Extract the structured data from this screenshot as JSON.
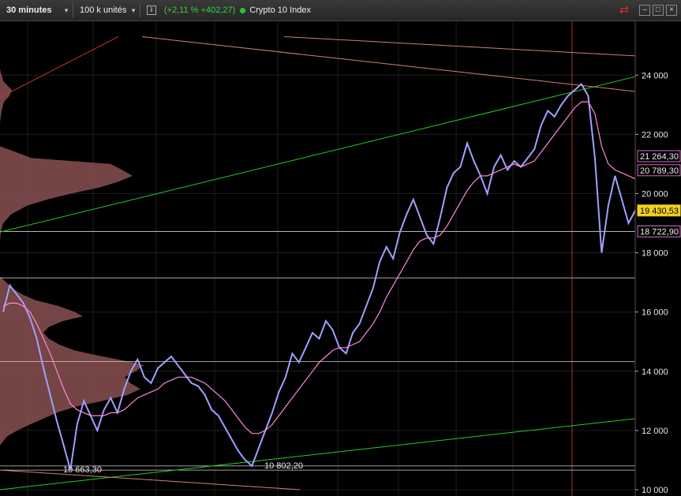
{
  "toolbar": {
    "timeframe": "30 minutes",
    "units": "100 k unités",
    "info_icon": "i",
    "change": "(+2,11 % +402,27)",
    "instrument": "Crypto 10 Index"
  },
  "colors": {
    "background": "#000000",
    "price": "#a0a0ff",
    "moving_average": "#ff88dd",
    "trendline_green": "#22cc22",
    "trendline_salmon": "#d08070",
    "volume_profile": "#8a5050",
    "last_price_tag": "#f0d020"
  },
  "chart_data": {
    "type": "line",
    "title": "",
    "xlabel": "",
    "ylabel": "",
    "ylim": [
      10000,
      25200
    ],
    "y_ticks": [
      "10 000",
      "12 000",
      "14 000",
      "16 000",
      "18 000",
      "20 000",
      "22 000",
      "24 000"
    ],
    "y_tick_values": [
      10000,
      12000,
      14000,
      16000,
      18000,
      20000,
      22000,
      24000
    ],
    "grid": true,
    "series": [
      {
        "values": [
          16000,
          16900,
          16600,
          16300,
          15800,
          15100,
          14100,
          13200,
          12300,
          11500,
          10663,
          12200,
          13000,
          12500,
          12000,
          12700,
          13100,
          12600,
          13400,
          14000,
          14400,
          13800,
          13600,
          14100,
          14300,
          14500,
          14200,
          13900,
          13600,
          13500,
          13200,
          12700,
          12500,
          12100,
          11700,
          11300,
          11000,
          10802,
          11400,
          12000,
          12600,
          13300,
          13800,
          14600,
          14300,
          14800,
          15300,
          15100,
          15700,
          15400,
          14800,
          14600,
          15300,
          15600,
          16200,
          16800,
          17700,
          18200,
          17800,
          18700,
          19300,
          19800,
          19200,
          18600,
          18300,
          19200,
          20200,
          20700,
          20900,
          21700,
          21100,
          20600,
          20000,
          20900,
          21300,
          20800,
          21100,
          20900,
          21200,
          21500,
          22300,
          22800,
          22600,
          23000,
          23300,
          23500,
          23700,
          23300,
          21200,
          18000,
          19600,
          20600,
          19800,
          19000,
          19430
        ]
      },
      {
        "values": [
          16200,
          16300,
          16300,
          16200,
          16000,
          15600,
          15100,
          14600,
          14000,
          13400,
          12900,
          12700,
          12600,
          12500,
          12500,
          12500,
          12600,
          12600,
          12700,
          12900,
          13100,
          13200,
          13300,
          13400,
          13600,
          13700,
          13800,
          13800,
          13800,
          13700,
          13600,
          13400,
          13200,
          13000,
          12700,
          12400,
          12100,
          11900,
          11900,
          12000,
          12200,
          12500,
          12800,
          13100,
          13400,
          13700,
          14000,
          14300,
          14500,
          14700,
          14800,
          14800,
          14900,
          15000,
          15300,
          15600,
          16000,
          16500,
          16900,
          17300,
          17700,
          18100,
          18400,
          18500,
          18500,
          18600,
          18900,
          19300,
          19700,
          20100,
          20400,
          20600,
          20600,
          20700,
          20800,
          20900,
          21000,
          20900,
          21000,
          21100,
          21400,
          21700,
          22000,
          22300,
          22600,
          22900,
          23100,
          23100,
          22700,
          21600,
          21000,
          20800,
          20700,
          20600,
          20500
        ]
      }
    ],
    "price_tags": [
      {
        "label": "21 264,30",
        "value": 21264.3
      },
      {
        "label": "20 789,30",
        "value": 20789.3
      },
      {
        "label": "19 430,53",
        "value": 19430.53,
        "current": true
      },
      {
        "label": "18 722,90",
        "value": 18722.9
      }
    ],
    "annotations": [
      {
        "text": "10 663,30",
        "value": 10663.3
      },
      {
        "text": "10 802,20",
        "value": 10802.2
      }
    ],
    "horizontal_lines": [
      18722.9,
      17150,
      14330,
      10802.2,
      10663.3
    ],
    "volume_profile": [
      [
        24800,
        0
      ],
      [
        24200,
        0
      ],
      [
        23800,
        4
      ],
      [
        23500,
        15
      ],
      [
        23300,
        12
      ],
      [
        23100,
        5
      ],
      [
        22800,
        2
      ],
      [
        22400,
        0
      ],
      [
        21600,
        0
      ],
      [
        21200,
        40
      ],
      [
        21000,
        140
      ],
      [
        20800,
        155
      ],
      [
        20600,
        168
      ],
      [
        20400,
        150
      ],
      [
        20200,
        125
      ],
      [
        20000,
        90
      ],
      [
        19800,
        60
      ],
      [
        19600,
        35
      ],
      [
        19300,
        14
      ],
      [
        19000,
        4
      ],
      [
        18700,
        1
      ],
      [
        18400,
        0
      ],
      [
        17200,
        0
      ],
      [
        17000,
        8
      ],
      [
        16800,
        16
      ],
      [
        16600,
        28
      ],
      [
        16400,
        45
      ],
      [
        16200,
        75
      ],
      [
        16000,
        95
      ],
      [
        15850,
        105
      ],
      [
        15700,
        80
      ],
      [
        15500,
        62
      ],
      [
        15300,
        55
      ],
      [
        15100,
        62
      ],
      [
        14900,
        75
      ],
      [
        14700,
        95
      ],
      [
        14500,
        130
      ],
      [
        14300,
        168
      ],
      [
        14200,
        182
      ],
      [
        14000,
        172
      ],
      [
        13800,
        158
      ],
      [
        13600,
        165
      ],
      [
        13400,
        178
      ],
      [
        13200,
        162
      ],
      [
        13000,
        130
      ],
      [
        12800,
        95
      ],
      [
        12600,
        72
      ],
      [
        12400,
        55
      ],
      [
        12200,
        38
      ],
      [
        12000,
        22
      ],
      [
        11800,
        9
      ],
      [
        11600,
        3
      ],
      [
        11500,
        0
      ]
    ]
  }
}
